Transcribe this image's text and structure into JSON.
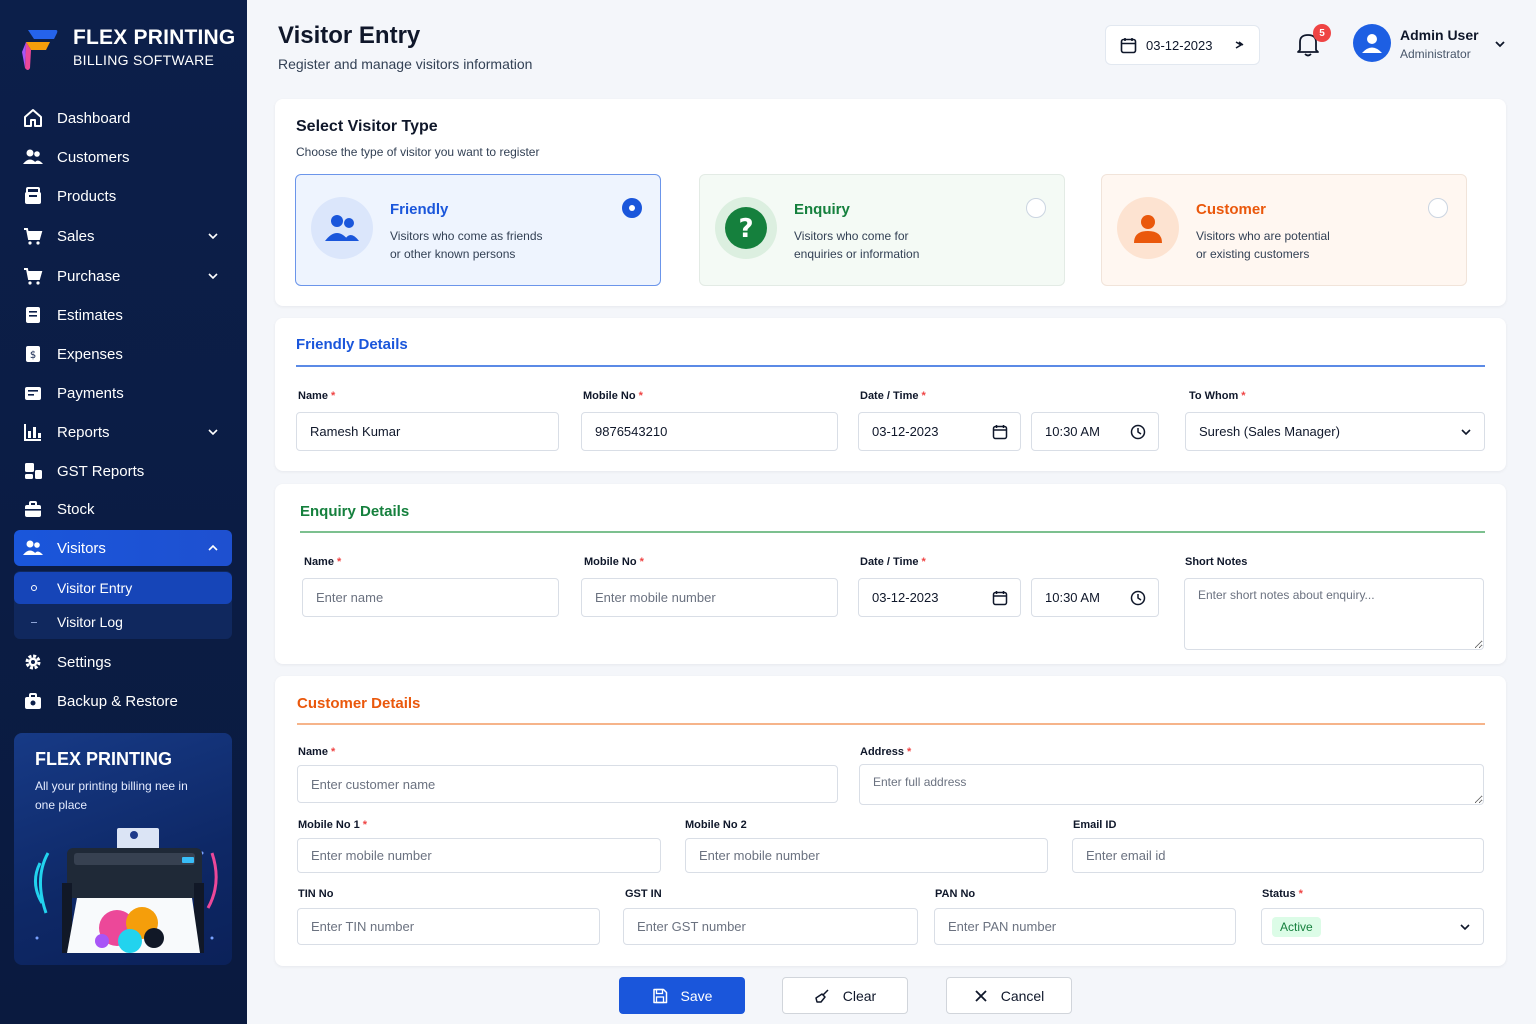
{
  "brand": {
    "title": "FLEX PRINTING",
    "subtitle": "BILLING SOFTWARE"
  },
  "sidebar": {
    "items": [
      {
        "label": "Dashboard",
        "icon": "home-icon"
      },
      {
        "label": "Customers",
        "icon": "users-icon"
      },
      {
        "label": "Products",
        "icon": "box-icon"
      },
      {
        "label": "Sales",
        "icon": "cart-icon"
      },
      {
        "label": "Purchase",
        "icon": "cart-icon"
      },
      {
        "label": "Estimates",
        "icon": "file-icon"
      },
      {
        "label": "Expenses",
        "icon": "receipt-icon"
      },
      {
        "label": "Payments",
        "icon": "wallet-icon"
      },
      {
        "label": "Reports",
        "icon": "bar-chart-icon"
      },
      {
        "label": "GST Reports",
        "icon": "gst-icon"
      },
      {
        "label": "Stock",
        "icon": "stock-icon"
      },
      {
        "label": "Visitors",
        "icon": "users-icon"
      },
      {
        "label": "Settings",
        "icon": "gear-icon"
      },
      {
        "label": "Backup & Restore",
        "icon": "backup-icon"
      }
    ],
    "visitor_sub": [
      "Visitor Entry",
      "Visitor Log"
    ],
    "promo": {
      "title": "FLEX PRINTING",
      "text": "All your printing billing nee in one place"
    }
  },
  "header": {
    "title": "Visitor Entry",
    "subtitle": "Register and manage visitors information",
    "date": "03-12-2023",
    "notif_count": "5",
    "user_name": "Admin User",
    "user_role": "Administrator"
  },
  "visitor_type": {
    "title": "Select Visitor Type",
    "subtitle": "Choose the type of visitor you want to register",
    "options": [
      {
        "title": "Friendly",
        "line1": "Visitors who come as friends",
        "line2": "or other known persons",
        "color": "#1a56db"
      },
      {
        "title": "Enquiry",
        "line1": "Visitors who come for",
        "line2": "enquiries or information",
        "color": "#15803d"
      },
      {
        "title": "Customer",
        "line1": "Visitors who are potential",
        "line2": "or existing customers",
        "color": "#ea580c"
      }
    ]
  },
  "friendly": {
    "title": "Friendly Details",
    "labels": {
      "name": "Name",
      "mobile": "Mobile No",
      "datetime": "Date / Time",
      "to_whom": "To Whom"
    },
    "values": {
      "name": "Ramesh Kumar",
      "mobile": "9876543210",
      "date": "03-12-2023",
      "time": "10:30 AM",
      "to_whom": "Suresh (Sales Manager)"
    }
  },
  "enquiry": {
    "title": "Enquiry Details",
    "labels": {
      "name": "Name",
      "mobile": "Mobile No",
      "datetime": "Date / Time",
      "notes": "Short Notes"
    },
    "placeholders": {
      "name": "Enter name",
      "mobile": "Enter mobile number",
      "notes": "Enter short notes about enquiry..."
    },
    "values": {
      "date": "03-12-2023",
      "time": "10:30 AM"
    }
  },
  "customer": {
    "title": "Customer Details",
    "labels": {
      "name": "Name",
      "address": "Address",
      "mobile1": "Mobile No 1",
      "mobile2": "Mobile No 2",
      "email": "Email ID",
      "tin": "TIN No",
      "gst": "GST IN",
      "pan": "PAN No",
      "status": "Status"
    },
    "placeholders": {
      "name": "Enter customer name",
      "address": "Enter full address",
      "mobile1": "Enter mobile number",
      "mobile2": "Enter mobile number",
      "email": "Enter email id",
      "tin": "Enter TIN number",
      "gst": "Enter GST number",
      "pan": "Enter PAN number"
    },
    "values": {
      "status": "Active"
    }
  },
  "actions": {
    "save": "Save",
    "clear": "Clear",
    "cancel": "Cancel"
  },
  "colors": {
    "sidebar": "#0c1f4a",
    "accent": "#1a56db",
    "enquiry": "#15803d",
    "customer": "#ea580c",
    "danger": "#ef4444"
  }
}
